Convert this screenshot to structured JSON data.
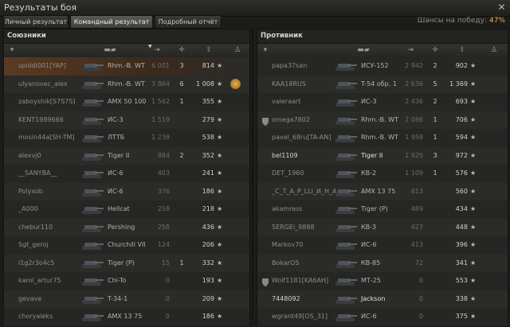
{
  "window": {
    "title": "Результаты боя",
    "close_icon": "close-icon"
  },
  "tabs": [
    {
      "label": "Личный результат",
      "active": false
    },
    {
      "label": "Командный результат",
      "active": true
    },
    {
      "label": "Подробный отчёт",
      "active": false
    }
  ],
  "win_chance": {
    "label": "Шансы на победу:",
    "value": "47%"
  },
  "allies": {
    "title": "Союзники",
    "rows": [
      {
        "player": "spiddi001[YAP]",
        "tank": "Rhm.-B. WT",
        "damage": "6 001",
        "kills": "3",
        "xp": "814",
        "medal": false,
        "alive": false,
        "mine": true
      },
      {
        "player": "ulyanovec_alex",
        "tank": "Rhm.-B. WT",
        "damage": "3 864",
        "kills": "6",
        "xp": "1 008",
        "medal": true,
        "alive": false,
        "mine": false
      },
      {
        "player": "zaboyshik[S7S7S]",
        "tank": "AMX 50 100",
        "damage": "1 562",
        "kills": "1",
        "xp": "355",
        "medal": false,
        "alive": false,
        "mine": false
      },
      {
        "player": "KENT1989666",
        "tank": "ИС-3",
        "damage": "1 519",
        "kills": "",
        "xp": "279",
        "medal": false,
        "alive": false,
        "mine": false
      },
      {
        "player": "mosin44a[SH-TM]",
        "tank": "ЛТТБ",
        "damage": "1 238",
        "kills": "",
        "xp": "538",
        "medal": false,
        "alive": false,
        "mine": false
      },
      {
        "player": "alexvj0",
        "tank": "Tiger II",
        "damage": "884",
        "kills": "2",
        "xp": "352",
        "medal": false,
        "alive": false,
        "mine": false
      },
      {
        "player": "__SANYBA__",
        "tank": "ИС-6",
        "damage": "403",
        "kills": "",
        "xp": "241",
        "medal": false,
        "alive": false,
        "mine": false
      },
      {
        "player": "Polyxob",
        "tank": "ИС-6",
        "damage": "376",
        "kills": "",
        "xp": "186",
        "medal": false,
        "alive": false,
        "mine": false
      },
      {
        "player": "_A000",
        "tank": "Hellcat",
        "damage": "258",
        "kills": "",
        "xp": "218",
        "medal": false,
        "alive": false,
        "mine": false
      },
      {
        "player": "chebur110",
        "tank": "Pershing",
        "damage": "258",
        "kills": "",
        "xp": "436",
        "medal": false,
        "alive": false,
        "mine": false
      },
      {
        "player": "Sgt_geroj",
        "tank": "Churchill VII",
        "damage": "124",
        "kills": "",
        "xp": "206",
        "medal": false,
        "alive": false,
        "mine": false
      },
      {
        "player": "i1g2r3o4c5",
        "tank": "Tiger (P)",
        "damage": "15",
        "kills": "1",
        "xp": "332",
        "medal": false,
        "alive": false,
        "mine": false
      },
      {
        "player": "karol_artur75",
        "tank": "Chi-To",
        "damage": "0",
        "kills": "",
        "xp": "193",
        "medal": false,
        "alive": false,
        "mine": false
      },
      {
        "player": "gevave",
        "tank": "T-34-1",
        "damage": "0",
        "kills": "",
        "xp": "209",
        "medal": false,
        "alive": false,
        "mine": false
      },
      {
        "player": "choryaleks",
        "tank": "AMX 13 75",
        "damage": "0",
        "kills": "",
        "xp": "186",
        "medal": false,
        "alive": false,
        "mine": false
      }
    ]
  },
  "enemies": {
    "title": "Противник",
    "rows": [
      {
        "player": "papa37san",
        "tank": "ИСУ-152",
        "damage": "2 942",
        "kills": "2",
        "xp": "902",
        "clan": false,
        "alive": false
      },
      {
        "player": "KAA18RUS",
        "tank": "T-54 обр. 1",
        "damage": "2 636",
        "kills": "5",
        "xp": "1 369",
        "clan": false,
        "alive": false
      },
      {
        "player": "valeraart",
        "tank": "ИС-3",
        "damage": "2 436",
        "kills": "2",
        "xp": "693",
        "clan": false,
        "alive": false
      },
      {
        "player": "omega7802",
        "tank": "Rhm.-B. WT",
        "damage": "2 086",
        "kills": "1",
        "xp": "706",
        "clan": true,
        "alive": false
      },
      {
        "player": "pavel_68ru[TA-AN]",
        "tank": "Rhm.-B. WT",
        "damage": "1 958",
        "kills": "1",
        "xp": "594",
        "clan": false,
        "alive": false
      },
      {
        "player": "bel1109",
        "tank": "Tiger II",
        "damage": "1 925",
        "kills": "3",
        "xp": "972",
        "clan": false,
        "alive": true
      },
      {
        "player": "DET_1960",
        "tank": "КВ-2",
        "damage": "1 109",
        "kills": "1",
        "xp": "576",
        "clan": false,
        "alive": false
      },
      {
        "player": "_C_T_A_P_LLI_И_H_A_",
        "tank": "AMX 13 75",
        "damage": "813",
        "kills": "",
        "xp": "560",
        "clan": false,
        "alive": false
      },
      {
        "player": "akamress",
        "tank": "Tiger (P)",
        "damage": "489",
        "kills": "",
        "xp": "434",
        "clan": false,
        "alive": false
      },
      {
        "player": "SERGEi_9888",
        "tank": "КВ-3",
        "damage": "427",
        "kills": "",
        "xp": "448",
        "clan": false,
        "alive": false
      },
      {
        "player": "Markov70",
        "tank": "ИС-6",
        "damage": "413",
        "kills": "",
        "xp": "396",
        "clan": false,
        "alive": false
      },
      {
        "player": "BokarOS",
        "tank": "КВ-85",
        "damage": "72",
        "kills": "",
        "xp": "341",
        "clan": false,
        "alive": false
      },
      {
        "player": "Wolf1181[KA6AH]",
        "tank": "МТ-25",
        "damage": "0",
        "kills": "",
        "xp": "553",
        "clan": true,
        "alive": false
      },
      {
        "player": "7448092",
        "tank": "Jackson",
        "damage": "0",
        "kills": "",
        "xp": "338",
        "clan": false,
        "alive": true
      },
      {
        "player": "wgrant49[OS_31]",
        "tank": "ИС-6",
        "damage": "0",
        "kills": "",
        "xp": "375",
        "clan": false,
        "alive": false
      }
    ]
  },
  "icons": {
    "platoon": "platoon-icon",
    "tank": "tank-icon",
    "damage": "damage-icon",
    "kills": "kills-icon",
    "xp": "xp-icon",
    "star": "star-icon"
  },
  "colors": {
    "accent": "#e0b24a",
    "own_row": "#5b3a22"
  }
}
